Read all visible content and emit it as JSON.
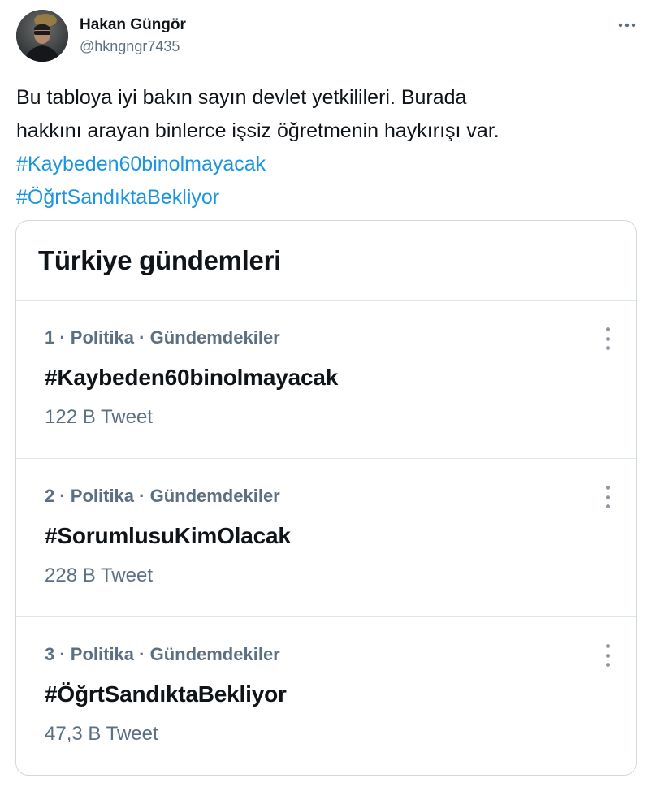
{
  "author": {
    "name": "Hakan Güngör",
    "handle": "@hkngngr7435"
  },
  "tweet": {
    "line1": "Bu tabloya iyi bakın sayın devlet yetkilileri. Burada",
    "line2": "hakkını arayan binlerce işsiz öğretmenin haykırışı var.",
    "hashtags": [
      "#Kaybeden60binolmayacak",
      "#ÖğrtSandıktaBekliyor"
    ]
  },
  "card": {
    "title": "Türkiye gündemleri",
    "trends": [
      {
        "meta": "1 · Politika · Gündemdekiler",
        "name": "#Kaybeden60binolmayacak",
        "count": "122 B Tweet"
      },
      {
        "meta": "2 · Politika · Gündemdekiler",
        "name": "#SorumlusuKimOlacak",
        "count": "228 B Tweet"
      },
      {
        "meta": "3 · Politika · Gündemdekiler",
        "name": "#ÖğrtSandıktaBekliyor",
        "count": "47,3 B Tweet"
      }
    ]
  },
  "colors": {
    "link": "#1b95e0",
    "secondary_text": "#5b7083",
    "primary_text": "#0f1419",
    "border": "#cfd9de"
  },
  "icons": {
    "tweet_menu": "more-horizontal-icon",
    "trend_menu": "more-vertical-icon"
  }
}
